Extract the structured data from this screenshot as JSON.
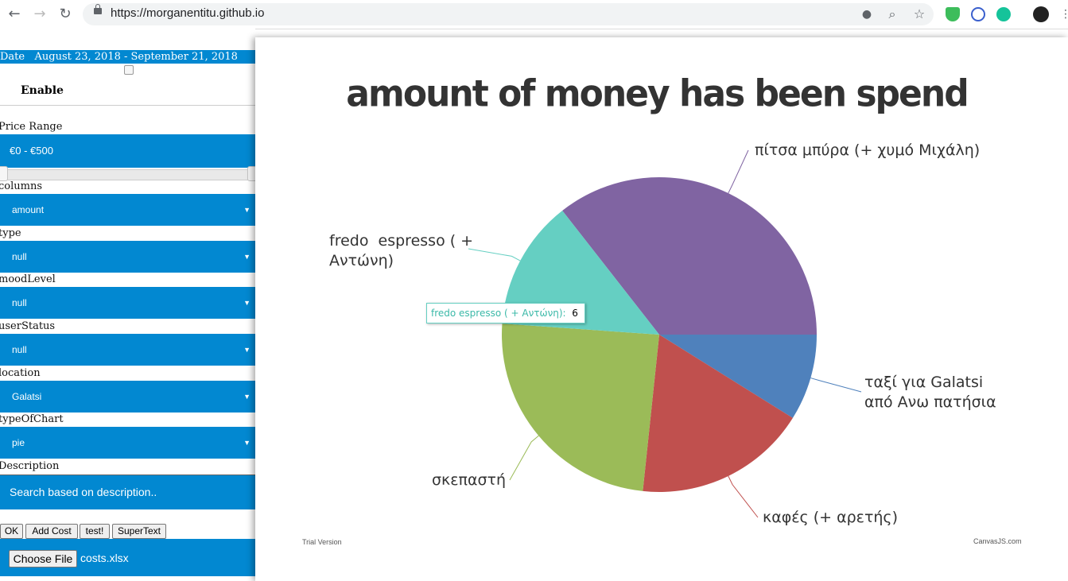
{
  "browser": {
    "url": "https://morganentitu.github.io"
  },
  "filters": {
    "date_label": "Date",
    "date_range": "August 23, 2018 - September 21, 2018",
    "enable_label": "Enable",
    "price_label": "Price Range",
    "price_value": "€0 - €500",
    "columns_label": "columns",
    "columns_value": "amount",
    "type_label": "type",
    "type_value": "null",
    "mood_label": "moodLevel",
    "mood_value": "null",
    "userstatus_label": "userStatus",
    "userstatus_value": "null",
    "location_label": "location",
    "location_value": "Galatsi",
    "charttype_label": "typeOfChart",
    "charttype_value": "pie",
    "description_label": "Description",
    "description_placeholder": "Search based on description.."
  },
  "actions": {
    "ok": "OK",
    "add_cost": "Add Cost",
    "test": "test!",
    "supertext": "SuperText",
    "choose_file": "Choose File",
    "file_name": "costs.xlsx"
  },
  "chart_footer": {
    "left": "Trial Version",
    "right": "CanvasJS.com"
  },
  "chart_data": {
    "type": "pie",
    "title": "amount of money has been spend",
    "slices": [
      {
        "label": "πίτσα μπύρα (+ χυμό Μιχάλη)",
        "value": 16,
        "color": "#8064a2"
      },
      {
        "label": "ταξί για Galatsi από Ανω πατήσια",
        "value": 4,
        "color": "#4f81bc"
      },
      {
        "label": "καφές (+ αρετής)",
        "value": 8,
        "color": "#c0504e"
      },
      {
        "label": "σκεπαστή",
        "value": 11,
        "color": "#9bbb58"
      },
      {
        "label": "fredo  espresso ( + Αντώνη)",
        "value": 6,
        "color": "#65cfc2"
      }
    ],
    "tooltip": {
      "label": "fredo espresso ( + Αντώνη):",
      "value": "6"
    }
  }
}
